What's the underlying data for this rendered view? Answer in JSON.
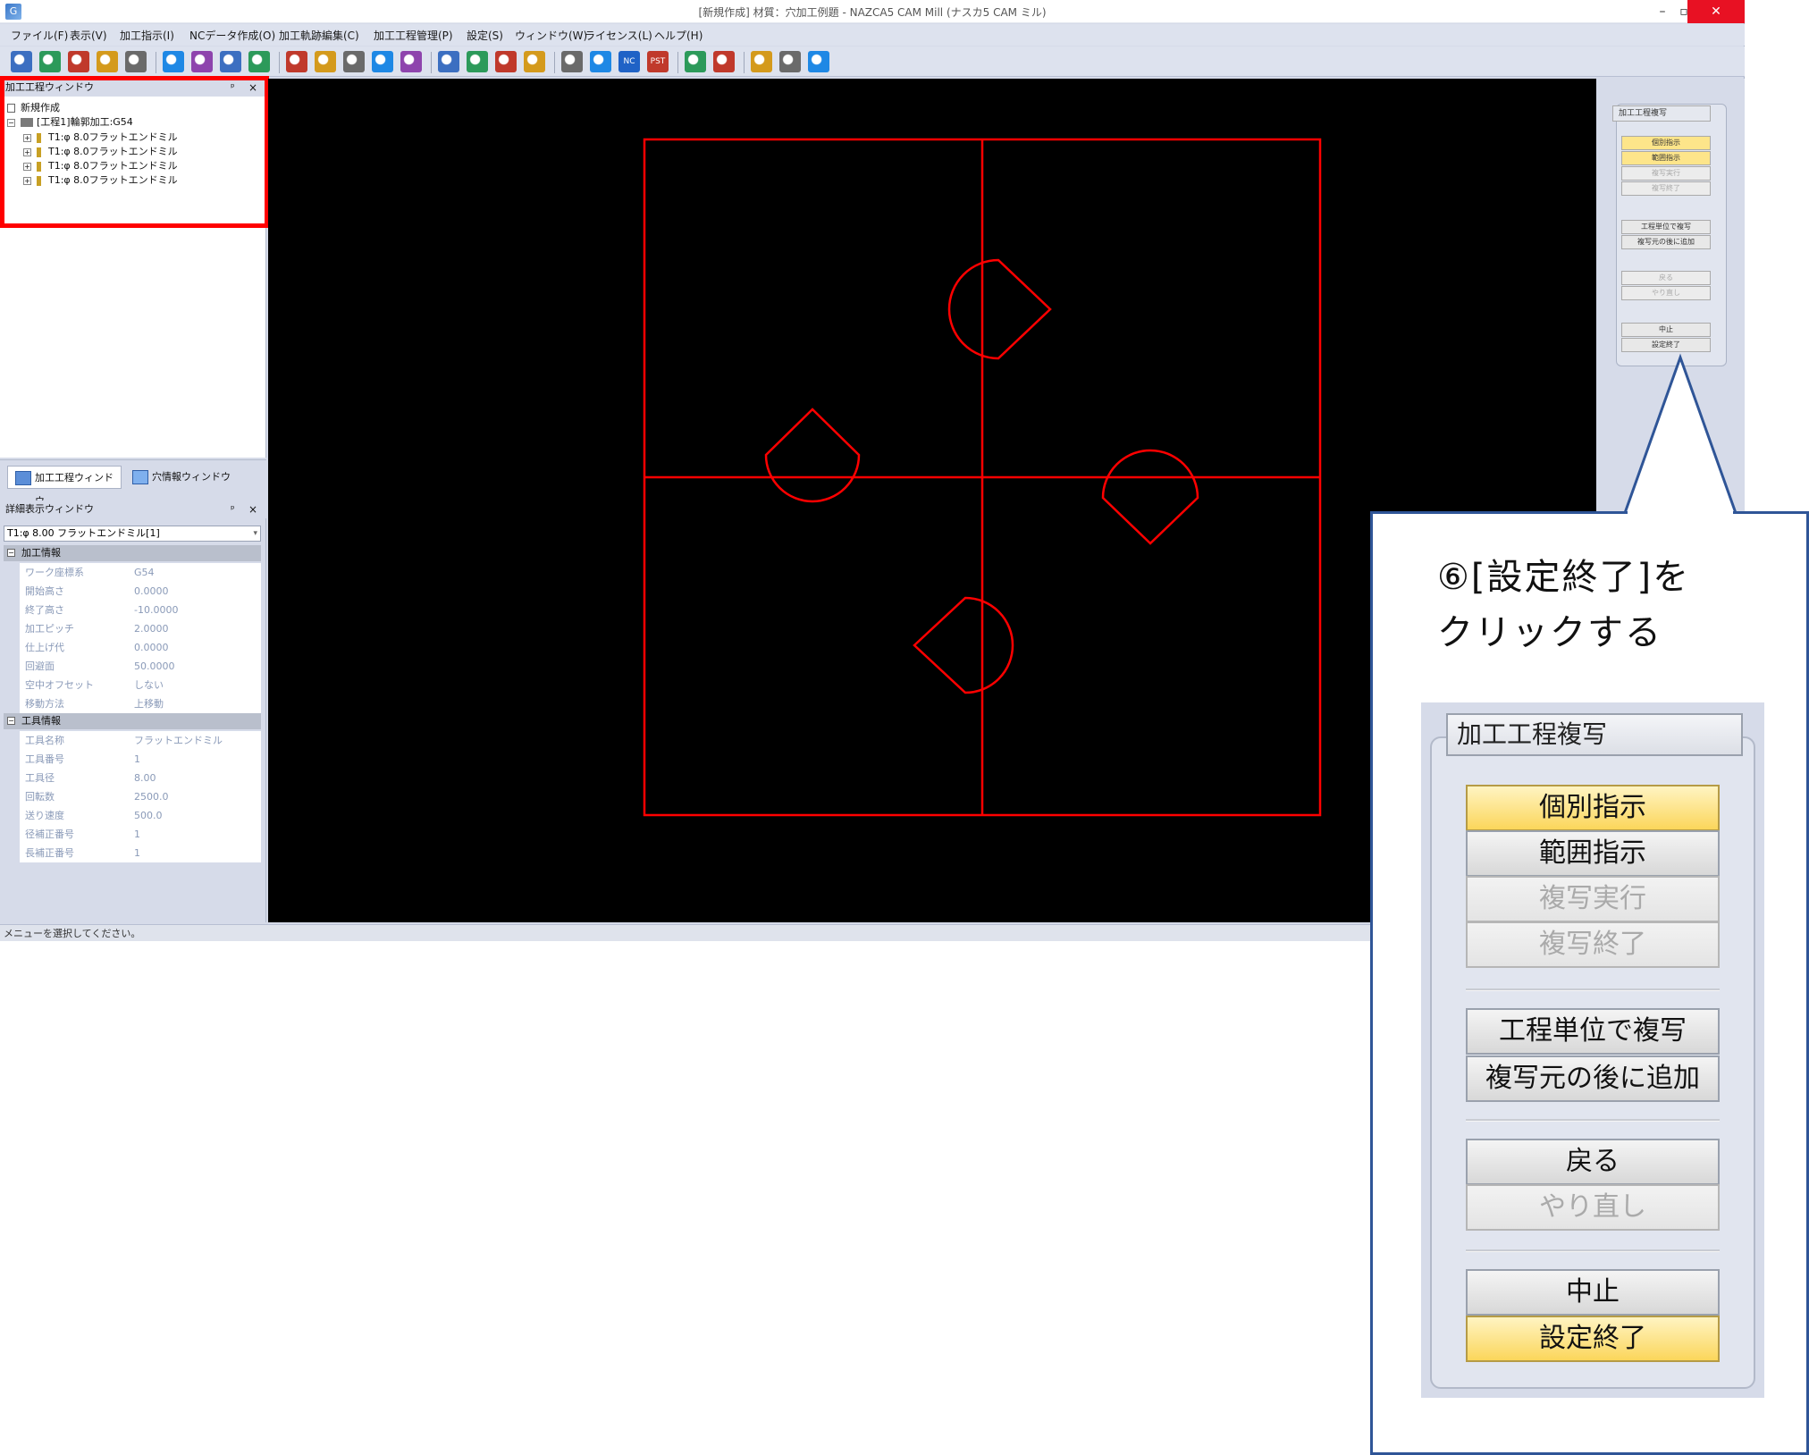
{
  "window": {
    "title": "[新規作成] 材質：穴加工例題 - NAZCA5 CAM Mill (ナスカ5 CAM ミル)",
    "logo": "G",
    "minimize": "–",
    "maximize": "▫",
    "close": "✕"
  },
  "menu": [
    "ファイル(F)",
    "表示(V)",
    "加工指示(I)",
    "NCデータ作成(O)",
    "加工軌跡編集(C)",
    "加工工程管理(P)",
    "設定(S)",
    "ウィンドウ(W)",
    "ライセンス(L)",
    "ヘルプ(H)"
  ],
  "toolbar_icons": [
    "zoom-in-icon",
    "zoom-all-icon",
    "zoom-window-icon",
    "zoom-out-icon",
    "zoom-fit-icon",
    "view-icon",
    "rotate-icon",
    "pan-icon",
    "hand-icon",
    "layer-icon",
    "shape-icon",
    "grid-icon",
    "cross-icon",
    "dim-icon",
    "create-icon",
    "2d-icon",
    "2d5-icon",
    "3d-icon",
    "machine-icon",
    "gear-icon",
    "nc-icon",
    "pst-icon",
    "undo-icon",
    "redo-icon",
    "list-icon",
    "tool-icon",
    "delete-icon"
  ],
  "toolbar_labels": {
    "nc": "NC",
    "pst": "PST"
  },
  "process_panel": {
    "title": "加工工程ウィンドウ",
    "pin": "ᵖ",
    "close": "×",
    "new_item": "新規作成",
    "process_node": "[工程1]輪郭加工:G54",
    "tools": [
      "T1:φ 8.0フラットエンドミル",
      "T1:φ 8.0フラットエンドミル",
      "T1:φ 8.0フラットエンドミル",
      "T1:φ 8.0フラットエンドミル"
    ]
  },
  "tabs": {
    "process": "加工工程ウィンドウ",
    "hole": "穴情報ウィンドウ"
  },
  "detail_panel": {
    "title": "詳細表示ウィンドウ",
    "selected": "T1:φ 8.00 フラットエンドミル[1]",
    "section1": "加工情報",
    "props1": [
      {
        "k": "ワーク座標系",
        "v": "G54"
      },
      {
        "k": "開始高さ",
        "v": "0.0000"
      },
      {
        "k": "終了高さ",
        "v": "-10.0000"
      },
      {
        "k": "加工ピッチ",
        "v": "2.0000"
      },
      {
        "k": "仕上げ代",
        "v": "0.0000"
      },
      {
        "k": "回避面",
        "v": "50.0000"
      },
      {
        "k": "空中オフセット",
        "v": "しない"
      },
      {
        "k": "移動方法",
        "v": "上移動"
      }
    ],
    "section2": "工具情報",
    "props2": [
      {
        "k": "工具名称",
        "v": "フラットエンドミル"
      },
      {
        "k": "工具番号",
        "v": "1"
      },
      {
        "k": "工具径",
        "v": "8.00"
      },
      {
        "k": "回転数",
        "v": "2500.0"
      },
      {
        "k": "送り速度",
        "v": "500.0"
      },
      {
        "k": "径補正番号",
        "v": "1"
      },
      {
        "k": "長補正番号",
        "v": "1"
      }
    ]
  },
  "status": "メニューを選択してください。",
  "copy_panel": {
    "title": "加工工程複写",
    "individual": "個別指示",
    "range": "範囲指示",
    "execute": "複写実行",
    "end_copy": "複写終了",
    "by_process": "工程単位で複写",
    "add_after": "複写元の後に追加",
    "back": "戻る",
    "redo": "やり直し",
    "cancel": "中止",
    "finish": "設定終了"
  },
  "callout": {
    "line1": "⑥[設定終了]を",
    "line2": "クリックする"
  },
  "colors": {
    "drawing": "#ff0000",
    "highlight": "#ff0000",
    "callout_border": "#2f5597",
    "button_active": "#fbd65b"
  }
}
